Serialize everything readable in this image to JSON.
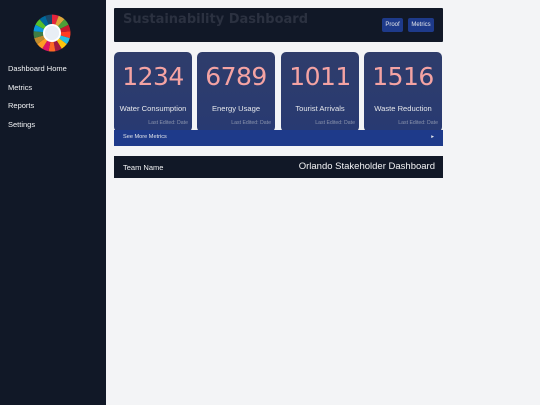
{
  "sidebar": {
    "logo_icon": "sdg-color-wheel-icon",
    "items": [
      {
        "label": "Dashboard Home"
      },
      {
        "label": "Metrics"
      },
      {
        "label": "Reports"
      },
      {
        "label": "Settings"
      }
    ]
  },
  "header": {
    "title": "Sustainability Dashboard",
    "buttons": [
      {
        "label": "Proof"
      },
      {
        "label": "Metrics"
      }
    ]
  },
  "cards": [
    {
      "value": "1234",
      "label": "Water Consumption",
      "edited": "Last Edited: Date"
    },
    {
      "value": "6789",
      "label": "Energy Usage",
      "edited": "Last Edited: Date"
    },
    {
      "value": "1011",
      "label": "Tourist Arrivals",
      "edited": "Last Edited: Date"
    },
    {
      "value": "1516",
      "label": "Waste Reduction",
      "edited": "Last Edited: Date"
    }
  ],
  "more_bar": {
    "label": "See More Metrics",
    "arrow": "▸"
  },
  "footer": {
    "team": "Team Name",
    "title": "Orlando Stakeholder Dashboard"
  },
  "colors": {
    "sidebar_bg": "#111827",
    "page_bg": "#f3f4f6",
    "card_bg": "#2f3d6b",
    "card_value": "#f4a3a3",
    "accent": "#1e3a8a"
  }
}
